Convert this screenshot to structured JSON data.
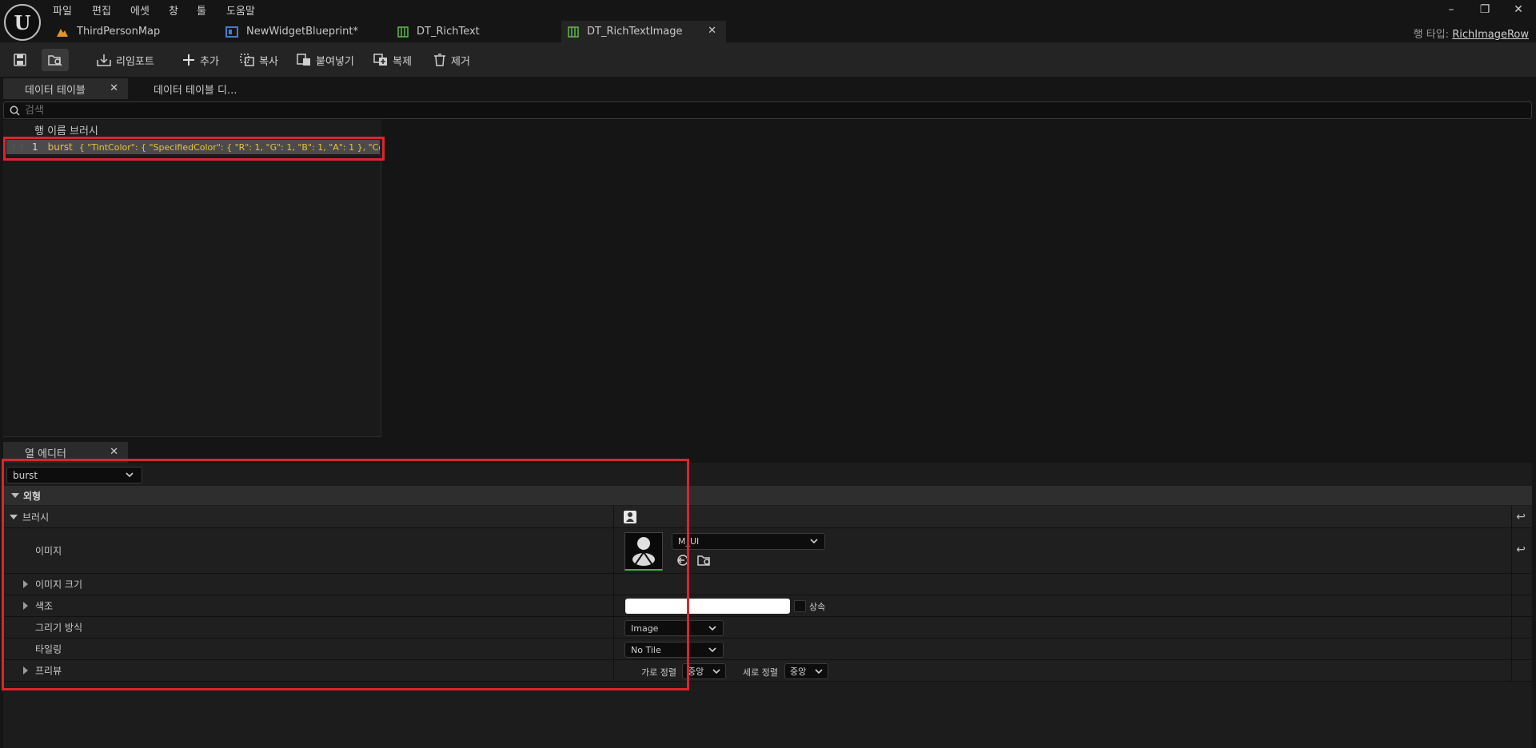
{
  "menu": [
    "파일",
    "편집",
    "에셋",
    "창",
    "툴",
    "도움말"
  ],
  "doc_tabs": [
    {
      "label": "ThirdPersonMap",
      "icon": "level-map-icon"
    },
    {
      "label": "NewWidgetBlueprint*",
      "icon": "widget-blueprint-icon"
    },
    {
      "label": "DT_RichText",
      "icon": "data-table-icon"
    },
    {
      "label": "DT_RichTextImage",
      "icon": "data-table-icon",
      "active": true
    }
  ],
  "row_type": {
    "label": "행 타입:",
    "value": "RichImageRow"
  },
  "toolbar": {
    "reimport": "리임포트",
    "add": "추가",
    "copy": "복사",
    "paste": "붙여넣기",
    "duplicate": "복제",
    "remove": "제거"
  },
  "panel_tabs": {
    "data_table": "데이터 테이블",
    "data_table_diff": "데이터 테이블 디...",
    "column_editor": "열 에디터"
  },
  "search": {
    "placeholder": "검색"
  },
  "table": {
    "headers": [
      "행 이름",
      "브러시"
    ],
    "rows": [
      {
        "index": "1",
        "name": "burst",
        "value": "{ \"TintColor\": { \"SpecifiedColor\": { \"R\": 1, \"G\": 1, \"B\": 1, \"A\": 1 }, \"ColorUseRul"
      }
    ]
  },
  "editor": {
    "selected_row": "burst",
    "section_appearance": "외형",
    "brush": "브러시",
    "image": "이미지",
    "image_asset": "M_UI",
    "image_size": "이미지 크기",
    "tint": "색조",
    "inherit": "상속",
    "draw_as": "그리기 방식",
    "draw_as_value": "Image",
    "tiling": "타일링",
    "tiling_value": "No Tile",
    "preview": "프리뷰",
    "h_align_label": "가로 정렬",
    "h_align_value": "중앙",
    "v_align_label": "세로 정렬",
    "v_align_value": "중앙"
  },
  "colors": {
    "highlight": "#d9262d",
    "row_name": "#e8c33b",
    "background": "#151515"
  }
}
